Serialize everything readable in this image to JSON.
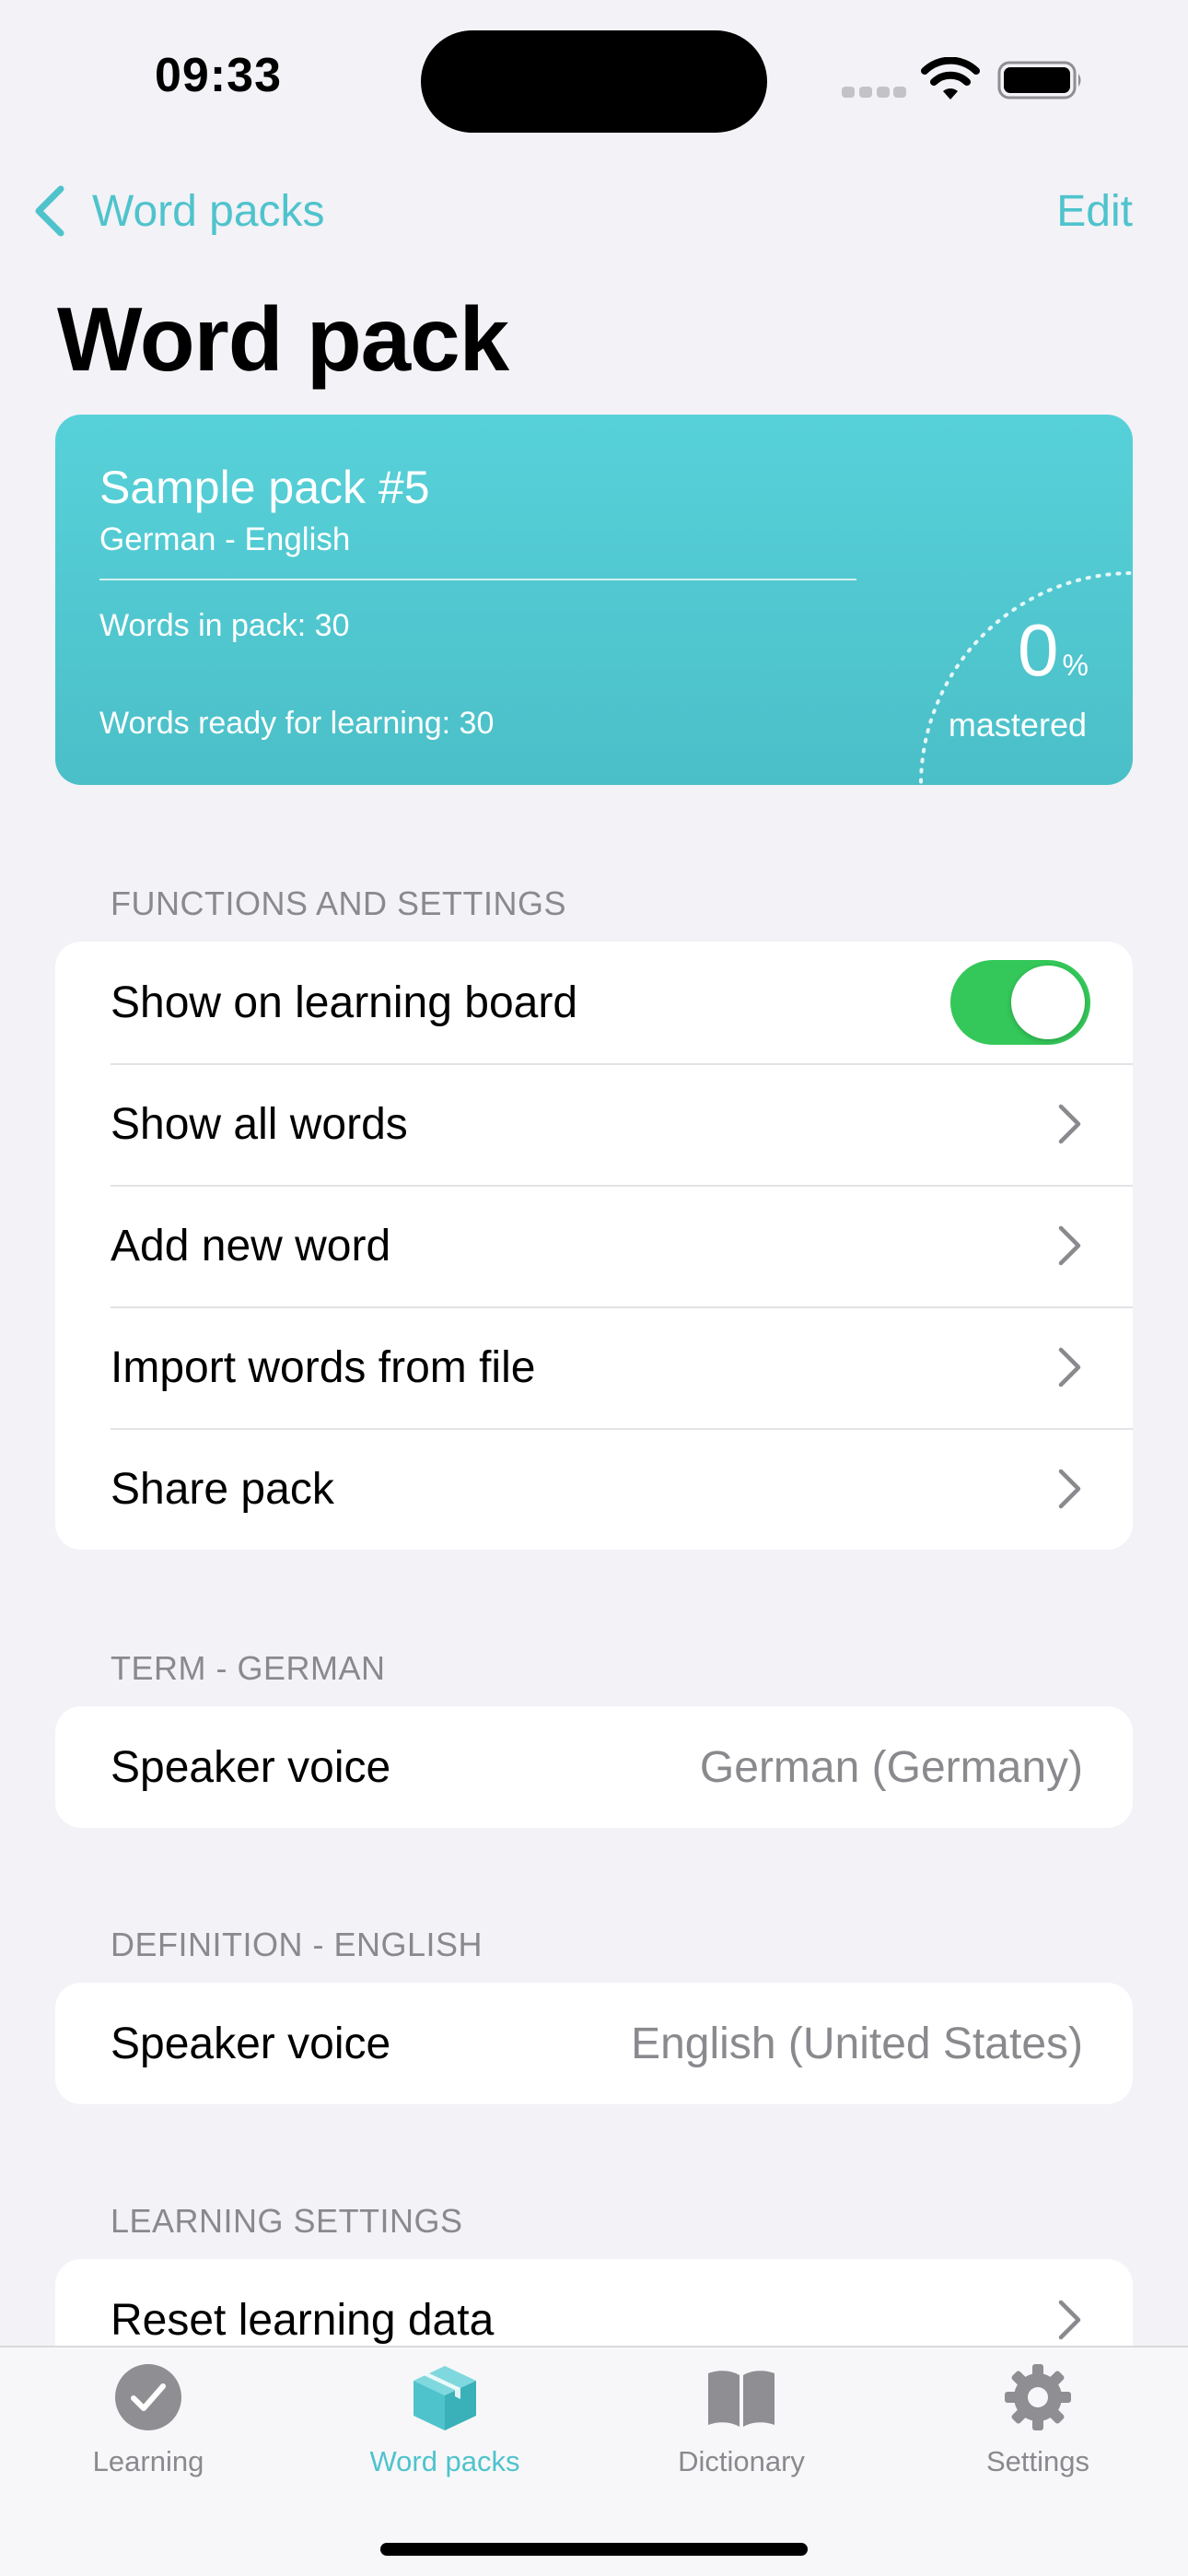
{
  "status": {
    "time": "09:33"
  },
  "nav": {
    "back_label": "Word packs",
    "edit_label": "Edit",
    "title": "Word pack"
  },
  "pack": {
    "name": "Sample pack #5",
    "languages": "German - English",
    "words_in_pack": "Words in pack: 30",
    "words_ready": "Words ready for learning: 30",
    "mastered_value": "0",
    "mastered_unit": "%",
    "mastered_label": "mastered",
    "mastered_fraction": 0
  },
  "functions": {
    "header": "FUNCTIONS AND SETTINGS",
    "show_on_board": {
      "label": "Show on learning board",
      "enabled": true
    },
    "items": [
      {
        "label": "Show all words"
      },
      {
        "label": "Add new word"
      },
      {
        "label": "Import words from file"
      },
      {
        "label": "Share pack"
      }
    ]
  },
  "term": {
    "header": "TERM - GERMAN",
    "label": "Speaker voice",
    "value": "German (Germany)"
  },
  "definition": {
    "header": "DEFINITION - ENGLISH",
    "label": "Speaker voice",
    "value": "English (United States)"
  },
  "learning": {
    "header": "LEARNING SETTINGS",
    "items": [
      {
        "label": "Reset learning data"
      }
    ]
  },
  "tabs": [
    {
      "label": "Learning",
      "icon": "checkmark-circle-icon",
      "active": false
    },
    {
      "label": "Word packs",
      "icon": "package-box-icon",
      "active": true
    },
    {
      "label": "Dictionary",
      "icon": "book-icon",
      "active": false
    },
    {
      "label": "Settings",
      "icon": "gear-icon",
      "active": false
    }
  ],
  "colors": {
    "accent": "#4fc3cc",
    "toggle_on": "#34c759",
    "background": "#f2f2f7",
    "secondary_text": "#8a8a8e"
  }
}
